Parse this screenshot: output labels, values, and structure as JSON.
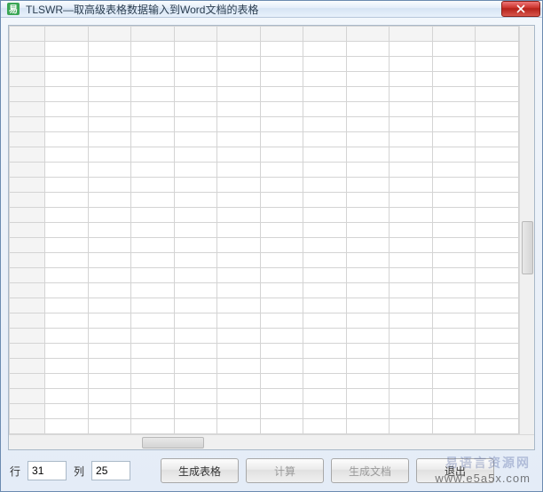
{
  "window": {
    "title": "TLSWR—取高级表格数据输入到Word文档的表格"
  },
  "grid": {
    "visible_rows": 27,
    "visible_cols": 12
  },
  "controls": {
    "row_label": "行",
    "row_value": "31",
    "col_label": "列",
    "col_value": "25",
    "generate_table": "生成表格",
    "calculate": "计算",
    "generate_doc": "生成文档",
    "exit": "退出"
  },
  "watermark": {
    "cn": "易语言资源网",
    "url": "www.e5a5x.com"
  }
}
